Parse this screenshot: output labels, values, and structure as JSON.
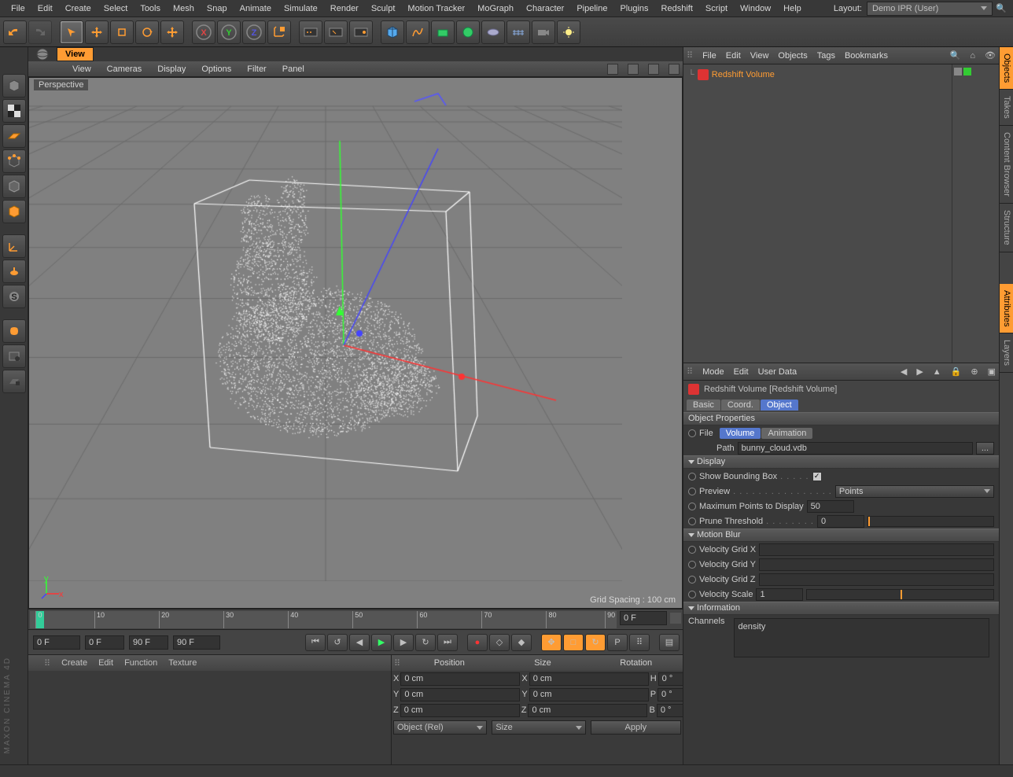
{
  "menubar": [
    "File",
    "Edit",
    "Create",
    "Select",
    "Tools",
    "Mesh",
    "Snap",
    "Animate",
    "Simulate",
    "Render",
    "Sculpt",
    "Motion Tracker",
    "MoGraph",
    "Character",
    "Pipeline",
    "Plugins",
    "Redshift",
    "Script",
    "Window",
    "Help"
  ],
  "layout": {
    "label": "Layout:",
    "value": "Demo IPR (User)"
  },
  "view_tab": "View",
  "view_menu": [
    "View",
    "Cameras",
    "Display",
    "Options",
    "Filter",
    "Panel"
  ],
  "perspective_label": "Perspective",
  "grid_spacing": "Grid Spacing : 100 cm",
  "timeline": {
    "ticks": [
      "0",
      "10",
      "20",
      "30",
      "40",
      "50",
      "60",
      "70",
      "80",
      "90"
    ],
    "endfield": "0 F"
  },
  "playback": {
    "cur": "0 F",
    "start": "0 F",
    "end": "90 F",
    "cur2": "90 F"
  },
  "bottom_left_menu": [
    "Create",
    "Edit",
    "Function",
    "Texture"
  ],
  "coords": {
    "headers": [
      "Position",
      "Size",
      "Rotation"
    ],
    "rows": [
      {
        "axis": "X",
        "pos": "0 cm",
        "saxis": "X",
        "size": "0 cm",
        "raxis": "H",
        "rot": "0 °"
      },
      {
        "axis": "Y",
        "pos": "0 cm",
        "saxis": "Y",
        "size": "0 cm",
        "raxis": "P",
        "rot": "0 °"
      },
      {
        "axis": "Z",
        "pos": "0 cm",
        "saxis": "Z",
        "size": "0 cm",
        "raxis": "B",
        "rot": "0 °"
      }
    ],
    "mode": "Object (Rel)",
    "sizemode": "Size",
    "apply": "Apply"
  },
  "om_menu": [
    "File",
    "Edit",
    "View",
    "Objects",
    "Tags",
    "Bookmarks"
  ],
  "om_object": "Redshift Volume",
  "attr_menu": [
    "Mode",
    "Edit",
    "User Data"
  ],
  "attr_title": "Redshift Volume [Redshift Volume]",
  "attr_tabs": [
    "Basic",
    "Coord.",
    "Object"
  ],
  "attr_active_tab": "Object",
  "obj_props": {
    "header": "Object Properties",
    "file_label": "File",
    "subtabs": [
      "Volume",
      "Animation"
    ],
    "active_subtab": "Volume",
    "path_label": "Path",
    "path_value": "bunny_cloud.vdb",
    "browse": "...",
    "display_header": "Display",
    "show_bbox": "Show Bounding Box",
    "show_bbox_checked": "✓",
    "preview_label": "Preview",
    "preview_value": "Points",
    "max_pts_label": "Maximum Points to Display",
    "max_pts_value": "50",
    "prune_label": "Prune Threshold",
    "prune_value": "0",
    "motion_header": "Motion Blur",
    "vgx": "Velocity Grid X",
    "vgy": "Velocity Grid Y",
    "vgz": "Velocity Grid Z",
    "vscale_label": "Velocity Scale",
    "vscale_value": "1",
    "info_header": "Information",
    "channels_label": "Channels",
    "channels_value": "density"
  },
  "right_tabs": [
    "Objects",
    "Takes",
    "Content Browser",
    "Structure",
    "Attributes",
    "Layers"
  ],
  "logo_text": "MAXON CINEMA 4D"
}
